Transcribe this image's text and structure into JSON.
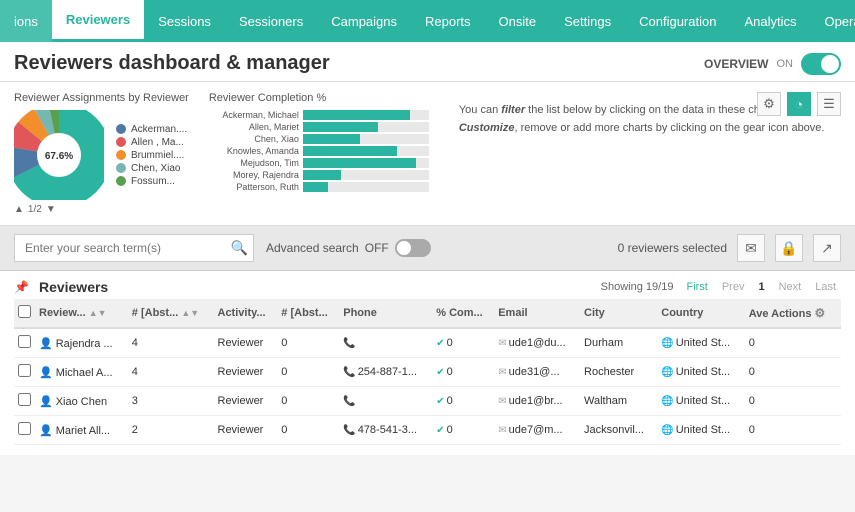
{
  "nav": {
    "items": [
      {
        "label": "ions",
        "active": false
      },
      {
        "label": "Reviewers",
        "active": true
      },
      {
        "label": "Sessions",
        "active": false
      },
      {
        "label": "Sessioners",
        "active": false
      },
      {
        "label": "Campaigns",
        "active": false
      },
      {
        "label": "Reports",
        "active": false
      },
      {
        "label": "Onsite",
        "active": false
      },
      {
        "label": "Settings",
        "active": false
      },
      {
        "label": "Configuration",
        "active": false
      },
      {
        "label": "Analytics",
        "active": false
      },
      {
        "label": "Operation",
        "active": false
      }
    ]
  },
  "page": {
    "title": "Reviewers dashboard & manager",
    "overview_label": "OVERVIEW",
    "overview_on": "ON"
  },
  "charts": {
    "pie_title": "Reviewer Assignments by Reviewer",
    "bar_title": "Reviewer Completion %",
    "info_text": "You can filter the list below by clicking on the data in these charts. Customize, remove or add more charts by clicking on the gear icon above.",
    "pie_legend": [
      {
        "label": "Ackerman....",
        "color": "#4e79a7"
      },
      {
        "label": "Allen , Ma...",
        "color": "#e15759"
      },
      {
        "label": "Brummiel....",
        "color": "#f28e2b"
      },
      {
        "label": "Chen, Xiao",
        "color": "#76b7b2"
      },
      {
        "label": "Fossum...",
        "color": "#59a14f"
      }
    ],
    "pie_percentage": "67.6%",
    "pie_page": "1/2",
    "bar_items": [
      {
        "label": "Ackerman, Michael",
        "pct": 85
      },
      {
        "label": "Allen, Mariet",
        "pct": 60
      },
      {
        "label": "Chen, Xiao",
        "pct": 45
      },
      {
        "label": "Knowles, Amanda",
        "pct": 75
      },
      {
        "label": "Mejudson, Tim",
        "pct": 90
      },
      {
        "label": "Morey, Rajendra",
        "pct": 30
      },
      {
        "label": "Patterson, Ruth",
        "pct": 20
      }
    ]
  },
  "search": {
    "placeholder": "Enter your search term(s)",
    "advanced_label": "Advanced search",
    "adv_state": "OFF",
    "selected_text": "0 reviewers selected"
  },
  "table": {
    "section_title": "Reviewers",
    "showing": "Showing 19/19",
    "pagination": {
      "first": "First",
      "prev": "Prev",
      "page": "1",
      "next": "Next",
      "last": "Last"
    },
    "columns": [
      {
        "label": "Review...",
        "sortable": true
      },
      {
        "label": "# [Abst...",
        "sortable": true
      },
      {
        "label": "Activity...",
        "sortable": false
      },
      {
        "label": "# [Abst...",
        "sortable": false
      },
      {
        "label": "Phone",
        "sortable": false
      },
      {
        "label": "% Com...",
        "sortable": false
      },
      {
        "label": "Email",
        "sortable": false
      },
      {
        "label": "City",
        "sortable": false
      },
      {
        "label": "Country",
        "sortable": false
      },
      {
        "label": "Ave Actions",
        "sortable": true
      }
    ],
    "rows": [
      {
        "name": "Rajendra ...",
        "abs": "4",
        "activity": "Reviewer",
        "abs2": "0",
        "phone": "",
        "pct": "0",
        "email": "ude1@du...",
        "city": "Durham",
        "country": "United St...",
        "ave": "0"
      },
      {
        "name": "Michael A...",
        "abs": "4",
        "activity": "Reviewer",
        "abs2": "0",
        "phone": "254-887-1...",
        "pct": "0",
        "email": "ude31@...",
        "city": "Rochester",
        "country": "United St...",
        "ave": "0"
      },
      {
        "name": "Xiao Chen",
        "abs": "3",
        "activity": "Reviewer",
        "abs2": "0",
        "phone": "",
        "pct": "0",
        "email": "ude1@br...",
        "city": "Waltham",
        "country": "United St...",
        "ave": "0"
      },
      {
        "name": "Mariet All...",
        "abs": "2",
        "activity": "Reviewer",
        "abs2": "0",
        "phone": "478-541-3...",
        "pct": "0",
        "email": "ude7@m...",
        "city": "Jacksonvil...",
        "country": "United St...",
        "ave": "0"
      }
    ]
  }
}
